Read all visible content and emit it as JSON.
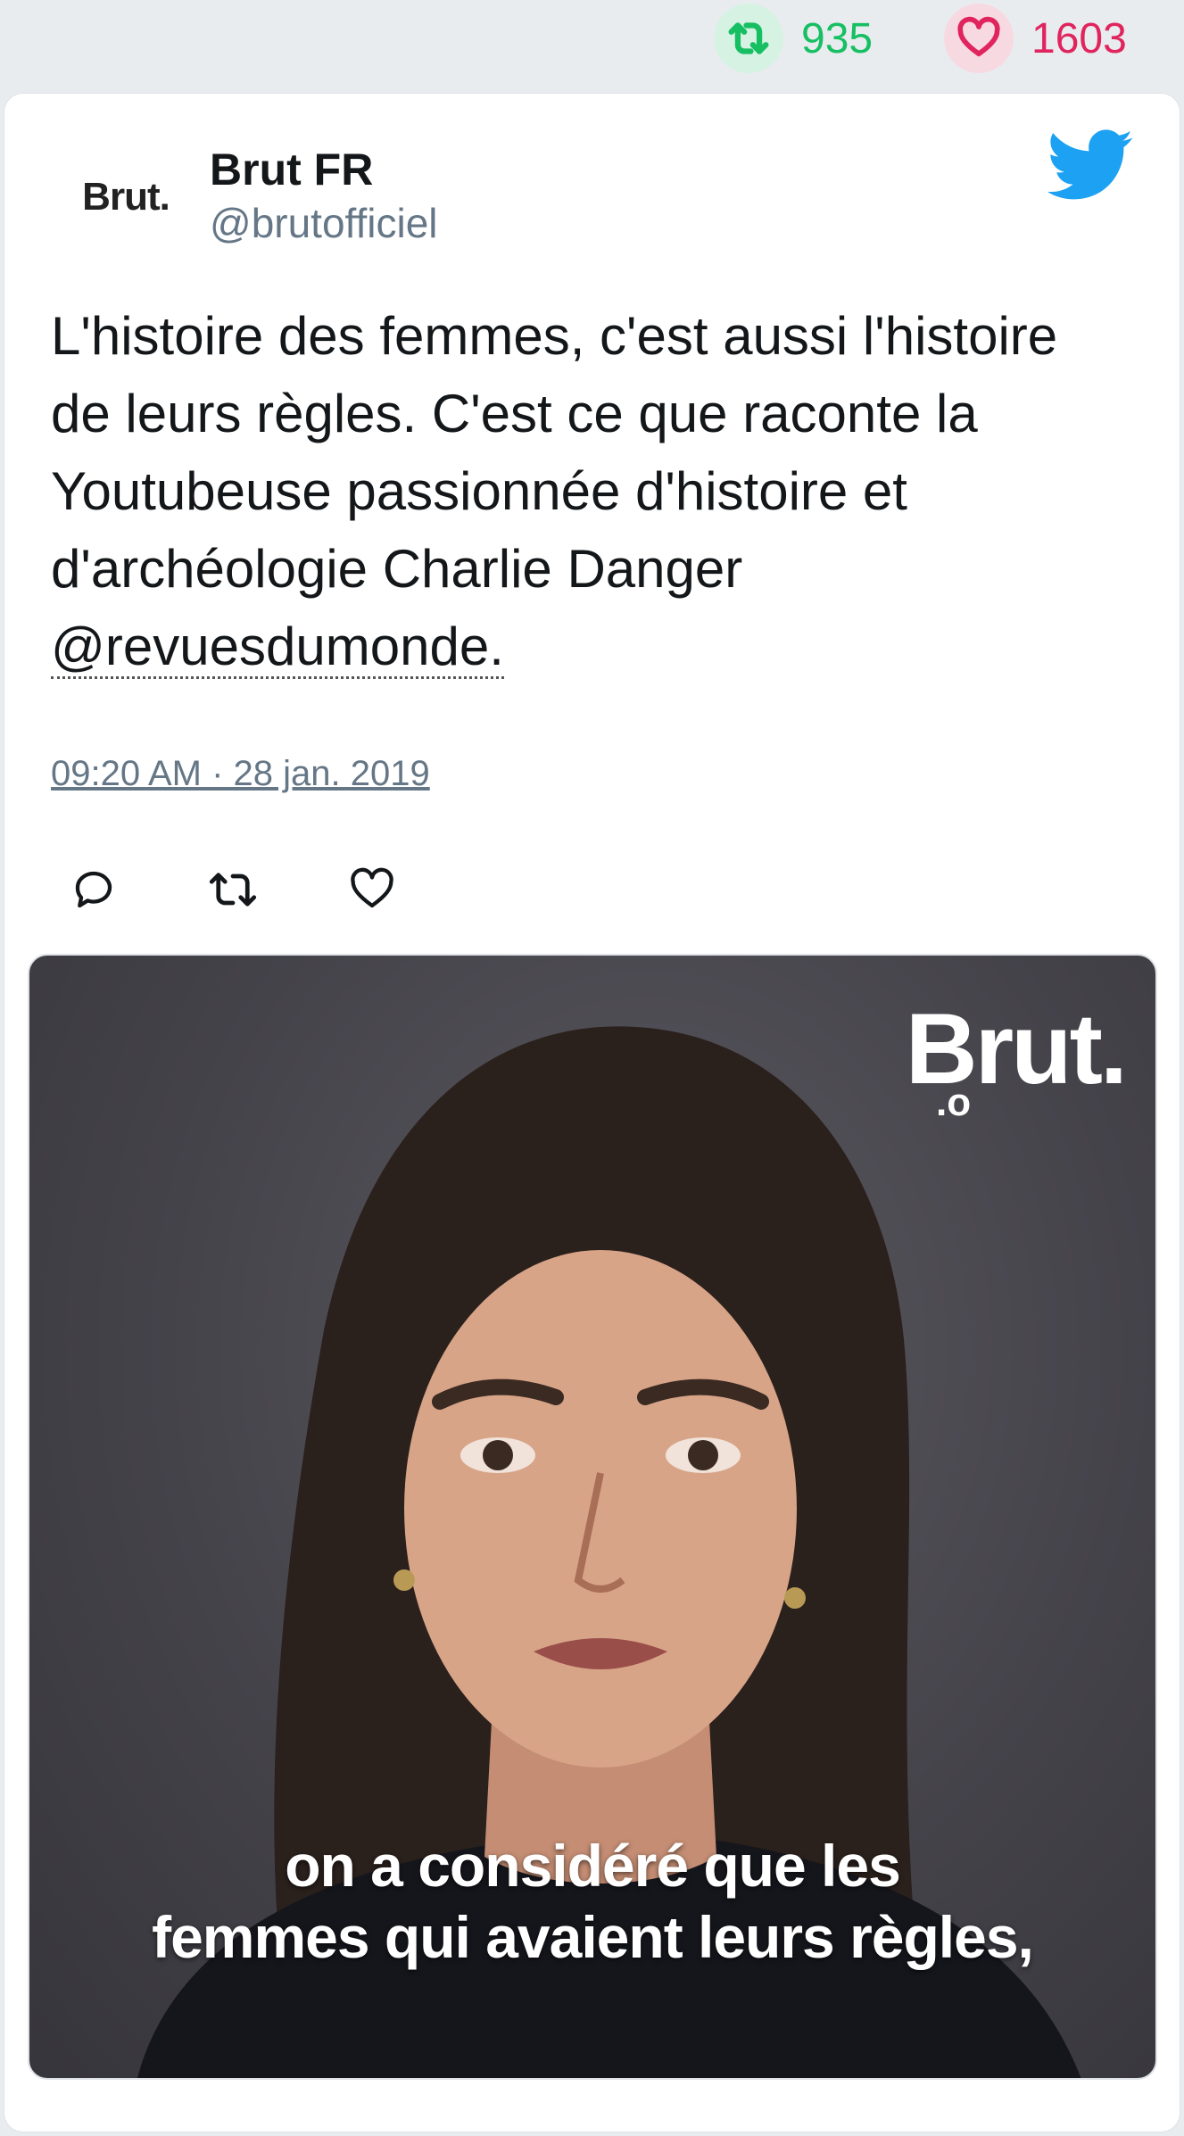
{
  "stats": {
    "retweets": "935",
    "likes": "1603",
    "retweet_color": "#17bf63",
    "like_color": "#e0245e"
  },
  "tweet": {
    "avatar_text": "Brut.",
    "display_name": "Brut FR",
    "handle": "@brutofficiel",
    "text_main": "L'histoire des femmes, c'est aussi l'histoire de leurs règles. C'est ce que raconte la Youtubeuse passionnée d'histoire et d'archéologie Charlie Danger ",
    "mention": "@revuesdumonde.",
    "timestamp": "09:20 AM · 28 jan. 2019",
    "icons": [
      "reply-icon",
      "retweet-icon",
      "like-icon",
      "twitter-bird-icon"
    ]
  },
  "media": {
    "logo": "Brut.",
    "logo_sub": ".o",
    "caption_line1": "on a considéré que les",
    "caption_line2": "femmes qui avaient leurs règles,"
  }
}
